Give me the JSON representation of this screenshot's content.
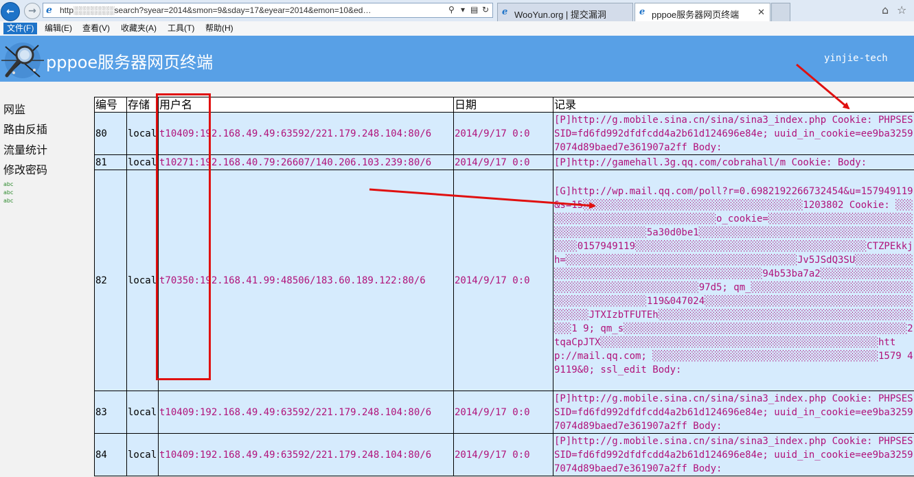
{
  "browser": {
    "address": "http░░░░░░░search?syear=2014&smon=9&sday=17&eyear=2014&emon=10&ed…",
    "tabs": [
      {
        "label": "WooYun.org | 提交漏洞"
      },
      {
        "label": "pppoe服务器网页终端"
      }
    ]
  },
  "menu": {
    "items": [
      "文件(F)",
      "编辑(E)",
      "查看(V)",
      "收藏夹(A)",
      "工具(T)",
      "帮助(H)"
    ]
  },
  "header": {
    "title": "pppoe服务器网页终端",
    "user": "yinjie-tech"
  },
  "sidebar": {
    "items": [
      "网监",
      "路由反插",
      "流量统计",
      "修改密码"
    ],
    "small_links": [
      "abc",
      "abc",
      "abc"
    ]
  },
  "table": {
    "columns": [
      "编号",
      "存储",
      "用户名",
      "日期",
      "记录"
    ],
    "rows": [
      {
        "id": "80",
        "store": "local",
        "user": "t10409:192.168.49.49:63592/221.179.248.104:80/6",
        "date": "2014/9/17 0:0",
        "record": "[P]http://g.mobile.sina.cn/sina/sina3_index.php Cookie: PHPSESSID=fd6fd992dfdfcdd4a2b61d124696e84e; uuid_in_cookie=ee9ba32597074d89baed7e361907a2ff Body:"
      },
      {
        "id": "81",
        "store": "local",
        "user": "t10271:192.168.40.79:26607/140.206.103.239:80/6",
        "date": "2014/9/17 0:0",
        "record": "[P]http://gamehall.3g.qq.com/cobrahall/m Cookie: Body:"
      },
      {
        "id": "82",
        "store": "local",
        "user": "t70350:192.168.41.99:48506/183.60.189.122:80/6",
        "date": "2014/9/17 0:0",
        "record": "[G]http://wp.mail.qq.com/poll?r=0.6982192266732454&u=157949119&s=15░░░░░░░░░░░░░░░░░░░░░░░░░░░░░░░░░░░░░░1203802 Cookie: ░░░░░░░░░░░░░░░░░░░░░░░░░░░░░░░o_cookie=░░░░░░░░░░░░░░░░░░░░░░░░░░░░░░░░░░░░░░░░░5a30d0be1░░░░░░░░░░░░░░░░░░░░░░░░░░░░░░░░░░░░░░░░░0157949119░░░░░░░░░░░░░░░░░░░░░░░░░░░░░░░░░░░░░░░░CTZPEkkjh=░░░░░░░░░░░░░░░░░░░░░░░░░░░░░░░░░░░░░░░░Jv5JSdQ3SU░░░░░░░░░░░░░░░░░░░░░░░░░░░░░░░░░░░░░░░░░░░░░░94b53ba7a2░░░░░░░░░░░░░░░░░░░░░░░░░░░░░░░░░░░░░░░░░97d5; qm_░░░░░░░░░░░░░░░░░░░░░░░░░░░░░░░░░░░░░░░░░░░░119&047024░░░░░░░░░░░░░░░░░░░░░░░░░░░░░░░░░░░░░░░░░░JTXIzbTFUTEh░░░░░░░░░░░░░░░░░░░░░░░░░░░░░░░░░░░░░░░░░░░░░░░1 9; qm_s░░░░░░░░░░░░░░░░░░░░░░░░░░░░░░░░░░░░░░░░░░░░░░░░░2tqaCpJTX░░░░░░░░░░░░░░░░░░░░░░░░░░░░░░░░░░░░░░░░░░░░░░░░http://mail.qq.com; ░░░░░░░░░░░░░░░░░░░░░░░░░░░░░░░░░░░░░░░1579 49119&0; ssl_edit Body:"
      },
      {
        "id": "83",
        "store": "local",
        "user": "t10409:192.168.49.49:63592/221.179.248.104:80/6",
        "date": "2014/9/17 0:0",
        "record": "[P]http://g.mobile.sina.cn/sina/sina3_index.php Cookie: PHPSESSID=fd6fd992dfdfcdd4a2b61d124696e84e; uuid_in_cookie=ee9ba32597074d89baed7e361907a2ff Body:"
      },
      {
        "id": "84",
        "store": "local",
        "user": "t10409:192.168.49.49:63592/221.179.248.104:80/6",
        "date": "2014/9/17 0:0",
        "record": "[P]http://g.mobile.sina.cn/sina/sina3_index.php Cookie: PHPSESSID=fd6fd992dfdfcdd4a2b61d124696e84e; uuid_in_cookie=ee9ba32597074d89baed7e361907a2ff Body:"
      }
    ]
  },
  "colors": {
    "header_bg": "#58a0e6",
    "row_bg": "#d6ebfd",
    "record_text": "#b0127a",
    "annotation_red": "#e01010"
  }
}
